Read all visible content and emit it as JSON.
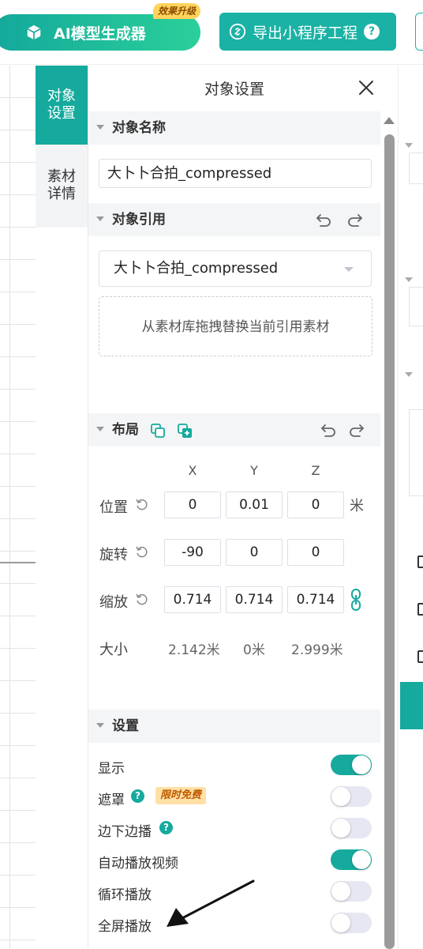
{
  "topbar": {
    "ai_button_label": "AI模型生成器",
    "upgrade_badge": "效果升级",
    "export_button_label": "导出小程序工程",
    "help_glyph": "?",
    "accent_color": "#15aa9d"
  },
  "side_tabs": [
    {
      "label_line1": "对象",
      "label_line2": "设置",
      "active": true
    },
    {
      "label_line1": "素材",
      "label_line2": "详情",
      "active": false
    }
  ],
  "panel": {
    "title": "对象设置",
    "close_icon": "close-icon",
    "object_name": {
      "header": "对象名称",
      "value": "大卜卜合拍_compressed"
    },
    "object_ref": {
      "header": "对象引用",
      "selected": "大卜卜合拍_compressed",
      "dropzone_text": "从素材库拖拽替换当前引用素材"
    },
    "layout": {
      "header": "布局",
      "columns": [
        "X",
        "Y",
        "Z"
      ],
      "position": {
        "label": "位置",
        "x": "0",
        "y": "0.01",
        "z": "0",
        "unit": "米"
      },
      "rotation": {
        "label": "旋转",
        "x": "-90",
        "y": "0",
        "z": "0"
      },
      "scale": {
        "label": "缩放",
        "x": "0.714",
        "y": "0.714",
        "z": "0.714"
      },
      "size": {
        "label": "大小",
        "x": "2.142米",
        "y": "0米",
        "z": "2.999米"
      }
    },
    "settings": {
      "header": "设置",
      "free_badge": "限时免费",
      "items": [
        {
          "label": "显示",
          "on": true
        },
        {
          "label": "遮罩",
          "on": false
        },
        {
          "label": "边下边播",
          "on": false
        },
        {
          "label": "自动播放视频",
          "on": true
        },
        {
          "label": "循环播放",
          "on": false
        },
        {
          "label": "全屏播放",
          "on": false
        }
      ]
    }
  }
}
